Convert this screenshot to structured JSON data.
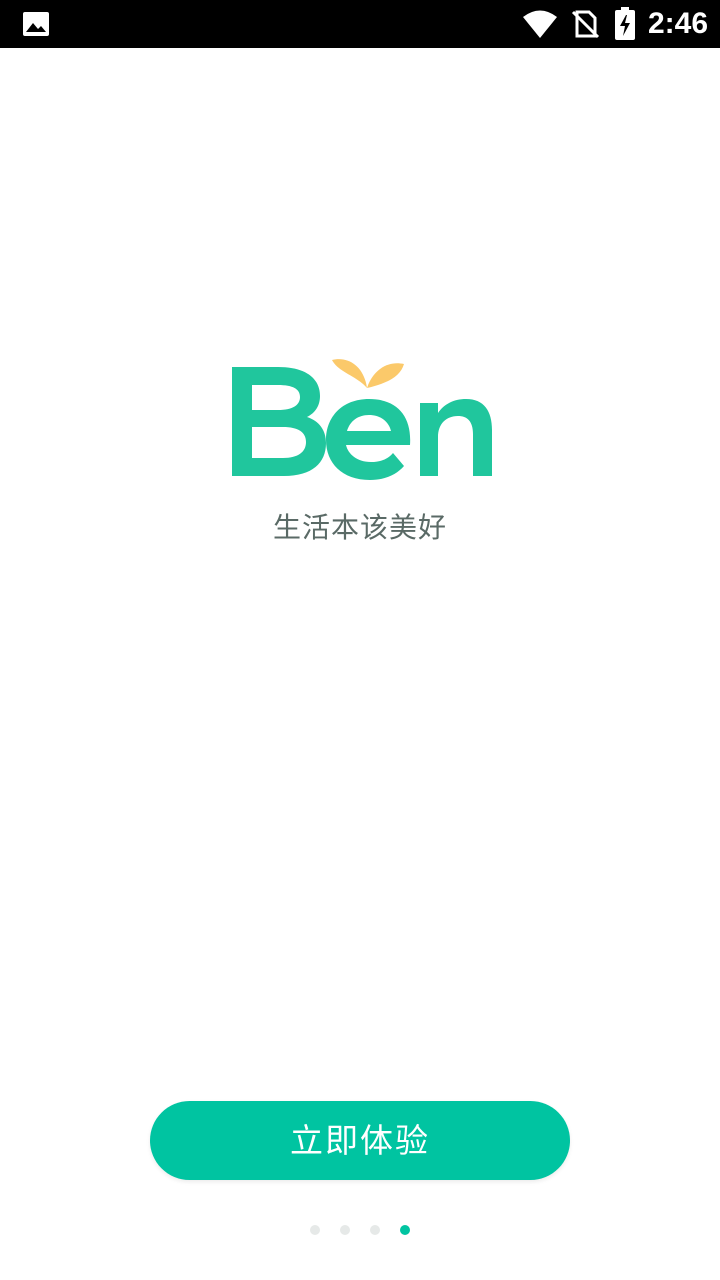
{
  "status_bar": {
    "time": "2:46",
    "icons": [
      "gallery-icon",
      "wifi-icon",
      "no-sim-icon",
      "battery-charging-icon"
    ]
  },
  "logo": {
    "text": "Ben",
    "brand_color": "#20c69d",
    "sprout_color": "#fbc96a"
  },
  "tagline": "生活本该美好",
  "cta_button": {
    "label": "立即体验",
    "color": "#00c4a1"
  },
  "page_indicator": {
    "total": 4,
    "active_index": 3,
    "active_color": "#00c4a1",
    "inactive_color": "#e6e9e8"
  }
}
